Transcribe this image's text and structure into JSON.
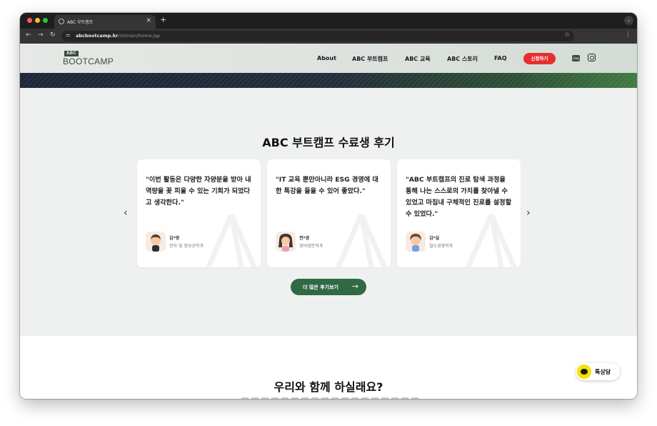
{
  "browser": {
    "tab_title": "ABC 부트캠프",
    "close_glyph": "×",
    "newtab_glyph": "+",
    "url_domain": "abcbootcamp.kr",
    "url_path": "/ct/main/home.jsp"
  },
  "header": {
    "logo_badge": "ABC",
    "logo_text": "BOOTCAMP",
    "nav": [
      "About",
      "ABC 부트캠프",
      "ABC 교육",
      "ABC 스토리",
      "FAQ"
    ],
    "apply_label": "신청하기",
    "blog_label": "blog"
  },
  "reviews": {
    "title": "ABC 부트캠프 수료생 후기",
    "cards": [
      {
        "quote": "\"이번 활동은 다양한 자양분을 받아 내 역량을 꽃 피울 수 있는 기회가 되었다고 생각한다.\"",
        "name": "김*영",
        "major": "전자 및 정보공학과"
      },
      {
        "quote": "\"IT 교육 뿐만아니라 ESG 경영에 대한 특강을 들을 수 있어 좋았다.\"",
        "name": "전*경",
        "major": "영어영문학과"
      },
      {
        "quote": "\"ABC 부트캠프의 진로 탐색 과정을 통해 나는 스스로의 가치를 찾아낼 수 있었고 마침내 구체적인 진로를 설정할 수 있었다.\"",
        "name": "김*실",
        "major": "철도경영학과"
      }
    ],
    "more_label": "더 많은 후기보기",
    "prev_glyph": "‹",
    "next_glyph": "›",
    "more_arrow": "→"
  },
  "join": {
    "title": "우리와 함께 하실래요?"
  },
  "chat": {
    "label": "톡상담"
  },
  "colors": {
    "accent_green": "#2f6a45",
    "apply_red": "#e62e2d",
    "kakao_yellow": "#fae100"
  }
}
